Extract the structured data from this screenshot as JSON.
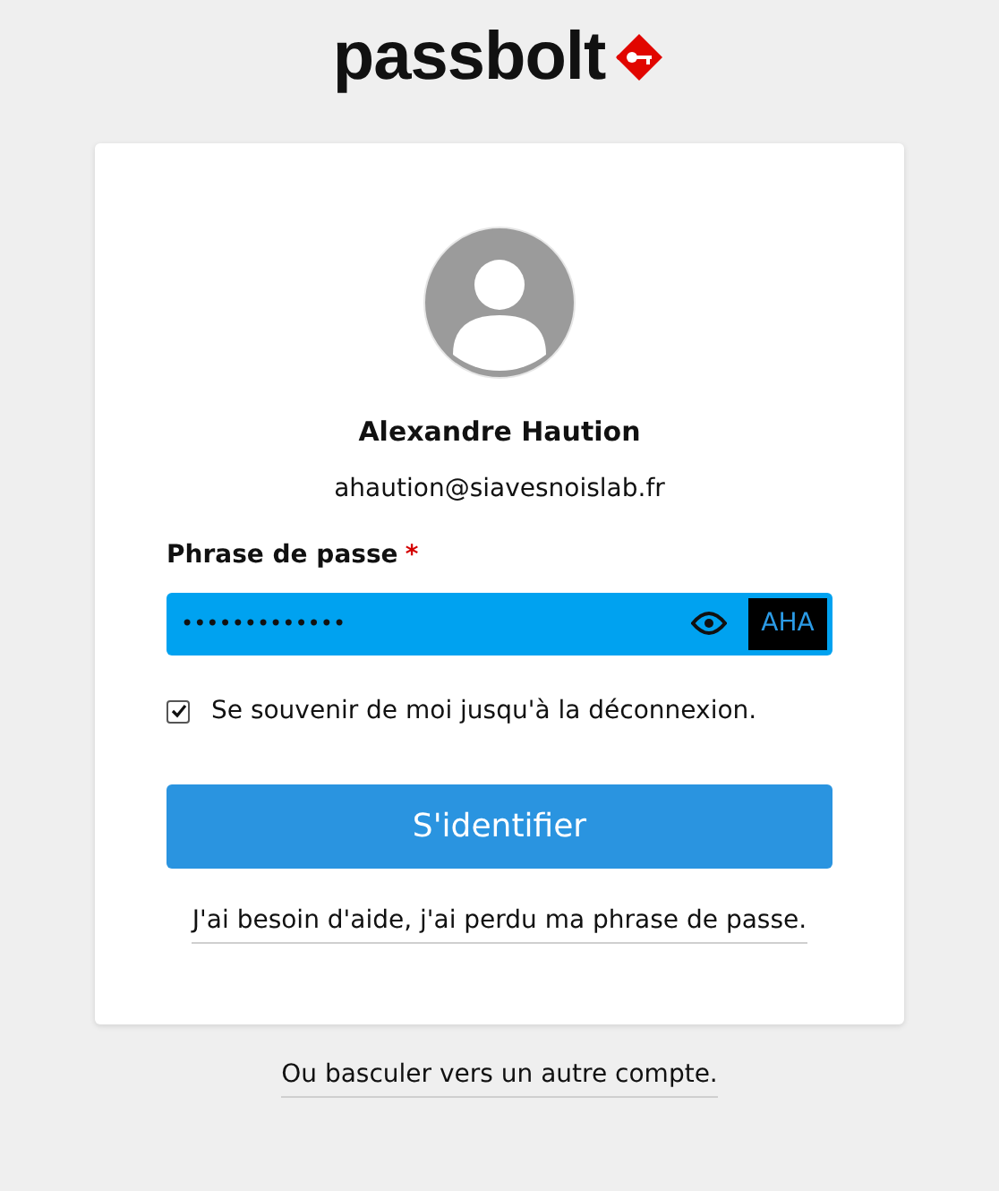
{
  "logo": {
    "text": "passbolt"
  },
  "user": {
    "name": "Alexandre Haution",
    "email": "ahaution@siavesnoislab.fr"
  },
  "passphrase": {
    "label": "Phrase de passe",
    "required_mark": "*",
    "value": "•••••••••••••",
    "security_token": "AHA"
  },
  "remember": {
    "label": "Se souvenir de moi jusqu'à la déconnexion.",
    "checked": true
  },
  "submit": {
    "label": "S'identifier"
  },
  "help_link": "J'ai besoin d'aide, j'ai perdu ma phrase de passe.",
  "switch_link": "Ou basculer vers un autre compte."
}
